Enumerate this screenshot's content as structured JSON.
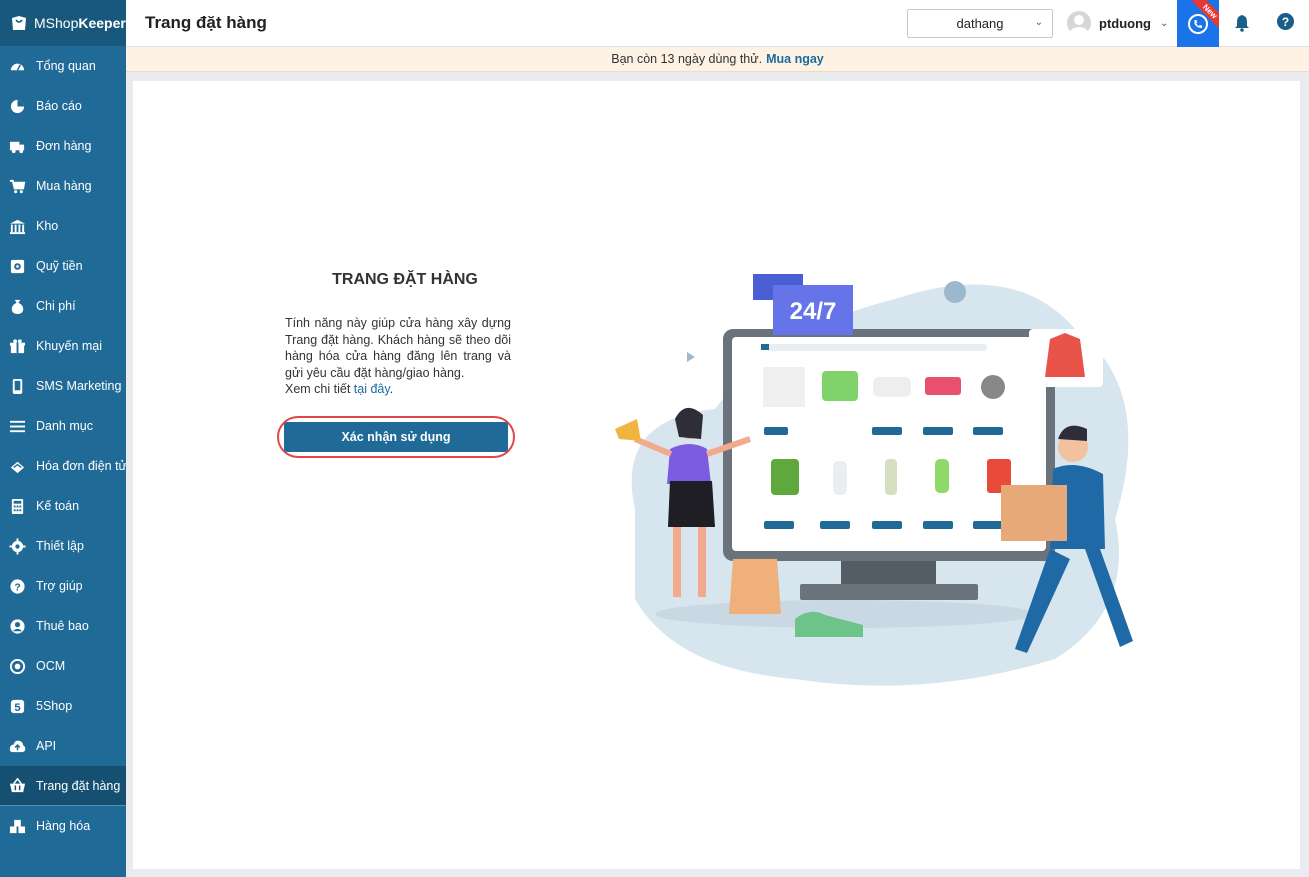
{
  "app": {
    "brand_light": "MShop",
    "brand_bold": "Keeper"
  },
  "sidebar": {
    "items": [
      {
        "label": "Tổng quan",
        "icon": "dashboard-icon"
      },
      {
        "label": "Báo cáo",
        "icon": "pie-chart-icon"
      },
      {
        "label": "Đơn hàng",
        "icon": "truck-icon"
      },
      {
        "label": "Mua hàng",
        "icon": "cart-icon"
      },
      {
        "label": "Kho",
        "icon": "warehouse-icon"
      },
      {
        "label": "Quỹ tiền",
        "icon": "safe-icon"
      },
      {
        "label": "Chi phí",
        "icon": "money-bag-icon"
      },
      {
        "label": "Khuyến mại",
        "icon": "gift-icon"
      },
      {
        "label": "SMS Marketing",
        "icon": "phone-icon"
      },
      {
        "label": "Danh mục",
        "icon": "list-icon"
      },
      {
        "label": "Hóa đơn điện tử",
        "icon": "invoice-icon"
      },
      {
        "label": "Kế toán",
        "icon": "calculator-icon"
      },
      {
        "label": "Thiết lập",
        "icon": "gear-icon"
      },
      {
        "label": "Trợ giúp",
        "icon": "question-icon"
      },
      {
        "label": "Thuê bao",
        "icon": "user-icon"
      },
      {
        "label": "OCM",
        "icon": "ocm-icon"
      },
      {
        "label": "5Shop",
        "icon": "fiveshop-icon"
      },
      {
        "label": "API",
        "icon": "cloud-upload-icon"
      },
      {
        "label": "Trang đặt hàng",
        "icon": "basket-icon",
        "active": true
      },
      {
        "label": "Hàng hóa",
        "icon": "boxes-icon"
      }
    ]
  },
  "header": {
    "title": "Trang đặt hàng",
    "store_select": "dathang",
    "username": "ptduong",
    "new_badge": "New",
    "help_glyph": "?"
  },
  "banner": {
    "text": "Bạn còn 13 ngày dùng thử.",
    "link": "Mua ngay"
  },
  "main": {
    "heading": "TRANG ĐẶT HÀNG",
    "description": "Tính năng này giúp cửa hàng xây dựng Trang đặt hàng. Khách hàng sẽ theo dõi hàng hóa cửa hàng đăng lên trang và gửi yêu cầu đặt hàng/giao hàng.",
    "detail_prefix": "Xem chi tiết ",
    "detail_link": "tại đây",
    "detail_suffix": ".",
    "confirm_button": "Xác nhận sử dụng",
    "illustration_badge": "24/7"
  },
  "colors": {
    "sidebar": "#1f6a96",
    "primary_button": "#1f6a96",
    "highlight_outline": "#e0474c",
    "phone_button": "#1a73e8"
  }
}
